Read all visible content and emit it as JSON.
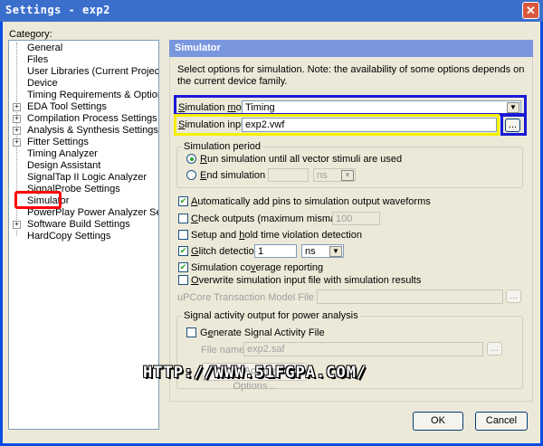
{
  "window": {
    "title": "Settings - exp2",
    "close_glyph": "✕"
  },
  "category_label": "Category:",
  "tree": [
    {
      "label": "General",
      "expandable": false
    },
    {
      "label": "Files",
      "expandable": false
    },
    {
      "label": "User Libraries (Current Project)",
      "expandable": false
    },
    {
      "label": "Device",
      "expandable": false
    },
    {
      "label": "Timing Requirements & Options",
      "expandable": false
    },
    {
      "label": "EDA Tool Settings",
      "expandable": true
    },
    {
      "label": "Compilation Process Settings",
      "expandable": true
    },
    {
      "label": "Analysis & Synthesis Settings",
      "expandable": true
    },
    {
      "label": "Fitter Settings",
      "expandable": true
    },
    {
      "label": "Timing Analyzer",
      "expandable": false
    },
    {
      "label": "Design Assistant",
      "expandable": false
    },
    {
      "label": "SignalTap II Logic Analyzer",
      "expandable": false
    },
    {
      "label": "SignalProbe Settings",
      "expandable": false
    },
    {
      "label": "Simulator",
      "expandable": false,
      "selected": true
    },
    {
      "label": "PowerPlay Power Analyzer Settings",
      "expandable": false
    },
    {
      "label": "Software Build Settings",
      "expandable": true
    },
    {
      "label": "HardCopy Settings",
      "expandable": false
    }
  ],
  "panel": {
    "header": "Simulator",
    "description": "Select options for simulation. Note: the availability of some options depends on the current device family.",
    "sim_mode_label": "Simulation mode:",
    "sim_mode_value": "Timing",
    "sim_input_label": "Simulation input:",
    "sim_input_value": "exp2.vwf",
    "browse_label": "...",
    "period_group": "Simulation period",
    "run_all_label": "Run simulation until all vector stimuli are used",
    "end_at_label": "End simulation at:",
    "end_at_unit": "ns",
    "auto_add_pins": "Automatically add pins to simulation output waveforms",
    "check_outputs": "Check outputs (maximum mismatches):",
    "check_outputs_value": "100",
    "setup_hold": "Setup and hold time violation detection",
    "glitch_label": "Glitch detection:",
    "glitch_value": "1",
    "glitch_unit": "ns",
    "coverage": "Simulation coverage reporting",
    "overwrite": "Overwrite simulation input file with simulation results",
    "upcore_label": "uPCore Transaction Model File Name:",
    "power_group": "Signal activity output for power analysis",
    "gen_saf": "Generate Signal Activity File",
    "file_name_label": "File name:",
    "file_name_value": "exp2.saf",
    "saf_options": "Signal Activity File Options..."
  },
  "buttons": {
    "ok": "OK",
    "cancel": "Cancel"
  },
  "watermark": "HTTP://WWW.51FGPA.COM/",
  "colors": {
    "title_bar": "#3a6fcc",
    "header": "#7a96df",
    "highlight_red": "#ff0000",
    "highlight_blue": "#1a1ad6",
    "highlight_yellow": "#f5f000"
  }
}
